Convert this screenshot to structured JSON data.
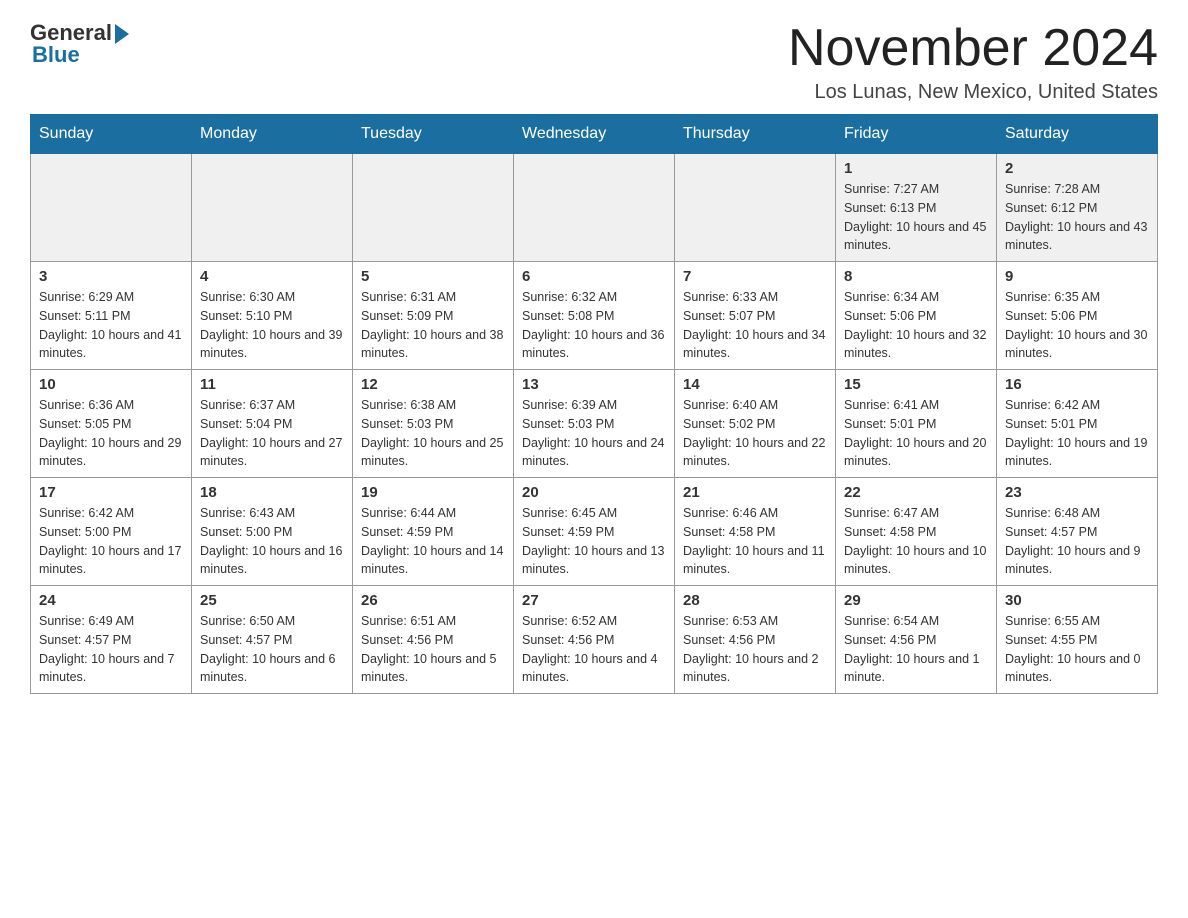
{
  "header": {
    "logo_general": "General",
    "logo_blue": "Blue",
    "month_title": "November 2024",
    "location": "Los Lunas, New Mexico, United States"
  },
  "days_of_week": [
    "Sunday",
    "Monday",
    "Tuesday",
    "Wednesday",
    "Thursday",
    "Friday",
    "Saturday"
  ],
  "weeks": [
    {
      "days": [
        {
          "num": "",
          "info": ""
        },
        {
          "num": "",
          "info": ""
        },
        {
          "num": "",
          "info": ""
        },
        {
          "num": "",
          "info": ""
        },
        {
          "num": "",
          "info": ""
        },
        {
          "num": "1",
          "info": "Sunrise: 7:27 AM\nSunset: 6:13 PM\nDaylight: 10 hours and 45 minutes."
        },
        {
          "num": "2",
          "info": "Sunrise: 7:28 AM\nSunset: 6:12 PM\nDaylight: 10 hours and 43 minutes."
        }
      ]
    },
    {
      "days": [
        {
          "num": "3",
          "info": "Sunrise: 6:29 AM\nSunset: 5:11 PM\nDaylight: 10 hours and 41 minutes."
        },
        {
          "num": "4",
          "info": "Sunrise: 6:30 AM\nSunset: 5:10 PM\nDaylight: 10 hours and 39 minutes."
        },
        {
          "num": "5",
          "info": "Sunrise: 6:31 AM\nSunset: 5:09 PM\nDaylight: 10 hours and 38 minutes."
        },
        {
          "num": "6",
          "info": "Sunrise: 6:32 AM\nSunset: 5:08 PM\nDaylight: 10 hours and 36 minutes."
        },
        {
          "num": "7",
          "info": "Sunrise: 6:33 AM\nSunset: 5:07 PM\nDaylight: 10 hours and 34 minutes."
        },
        {
          "num": "8",
          "info": "Sunrise: 6:34 AM\nSunset: 5:06 PM\nDaylight: 10 hours and 32 minutes."
        },
        {
          "num": "9",
          "info": "Sunrise: 6:35 AM\nSunset: 5:06 PM\nDaylight: 10 hours and 30 minutes."
        }
      ]
    },
    {
      "days": [
        {
          "num": "10",
          "info": "Sunrise: 6:36 AM\nSunset: 5:05 PM\nDaylight: 10 hours and 29 minutes."
        },
        {
          "num": "11",
          "info": "Sunrise: 6:37 AM\nSunset: 5:04 PM\nDaylight: 10 hours and 27 minutes."
        },
        {
          "num": "12",
          "info": "Sunrise: 6:38 AM\nSunset: 5:03 PM\nDaylight: 10 hours and 25 minutes."
        },
        {
          "num": "13",
          "info": "Sunrise: 6:39 AM\nSunset: 5:03 PM\nDaylight: 10 hours and 24 minutes."
        },
        {
          "num": "14",
          "info": "Sunrise: 6:40 AM\nSunset: 5:02 PM\nDaylight: 10 hours and 22 minutes."
        },
        {
          "num": "15",
          "info": "Sunrise: 6:41 AM\nSunset: 5:01 PM\nDaylight: 10 hours and 20 minutes."
        },
        {
          "num": "16",
          "info": "Sunrise: 6:42 AM\nSunset: 5:01 PM\nDaylight: 10 hours and 19 minutes."
        }
      ]
    },
    {
      "days": [
        {
          "num": "17",
          "info": "Sunrise: 6:42 AM\nSunset: 5:00 PM\nDaylight: 10 hours and 17 minutes."
        },
        {
          "num": "18",
          "info": "Sunrise: 6:43 AM\nSunset: 5:00 PM\nDaylight: 10 hours and 16 minutes."
        },
        {
          "num": "19",
          "info": "Sunrise: 6:44 AM\nSunset: 4:59 PM\nDaylight: 10 hours and 14 minutes."
        },
        {
          "num": "20",
          "info": "Sunrise: 6:45 AM\nSunset: 4:59 PM\nDaylight: 10 hours and 13 minutes."
        },
        {
          "num": "21",
          "info": "Sunrise: 6:46 AM\nSunset: 4:58 PM\nDaylight: 10 hours and 11 minutes."
        },
        {
          "num": "22",
          "info": "Sunrise: 6:47 AM\nSunset: 4:58 PM\nDaylight: 10 hours and 10 minutes."
        },
        {
          "num": "23",
          "info": "Sunrise: 6:48 AM\nSunset: 4:57 PM\nDaylight: 10 hours and 9 minutes."
        }
      ]
    },
    {
      "days": [
        {
          "num": "24",
          "info": "Sunrise: 6:49 AM\nSunset: 4:57 PM\nDaylight: 10 hours and 7 minutes."
        },
        {
          "num": "25",
          "info": "Sunrise: 6:50 AM\nSunset: 4:57 PM\nDaylight: 10 hours and 6 minutes."
        },
        {
          "num": "26",
          "info": "Sunrise: 6:51 AM\nSunset: 4:56 PM\nDaylight: 10 hours and 5 minutes."
        },
        {
          "num": "27",
          "info": "Sunrise: 6:52 AM\nSunset: 4:56 PM\nDaylight: 10 hours and 4 minutes."
        },
        {
          "num": "28",
          "info": "Sunrise: 6:53 AM\nSunset: 4:56 PM\nDaylight: 10 hours and 2 minutes."
        },
        {
          "num": "29",
          "info": "Sunrise: 6:54 AM\nSunset: 4:56 PM\nDaylight: 10 hours and 1 minute."
        },
        {
          "num": "30",
          "info": "Sunrise: 6:55 AM\nSunset: 4:55 PM\nDaylight: 10 hours and 0 minutes."
        }
      ]
    }
  ]
}
